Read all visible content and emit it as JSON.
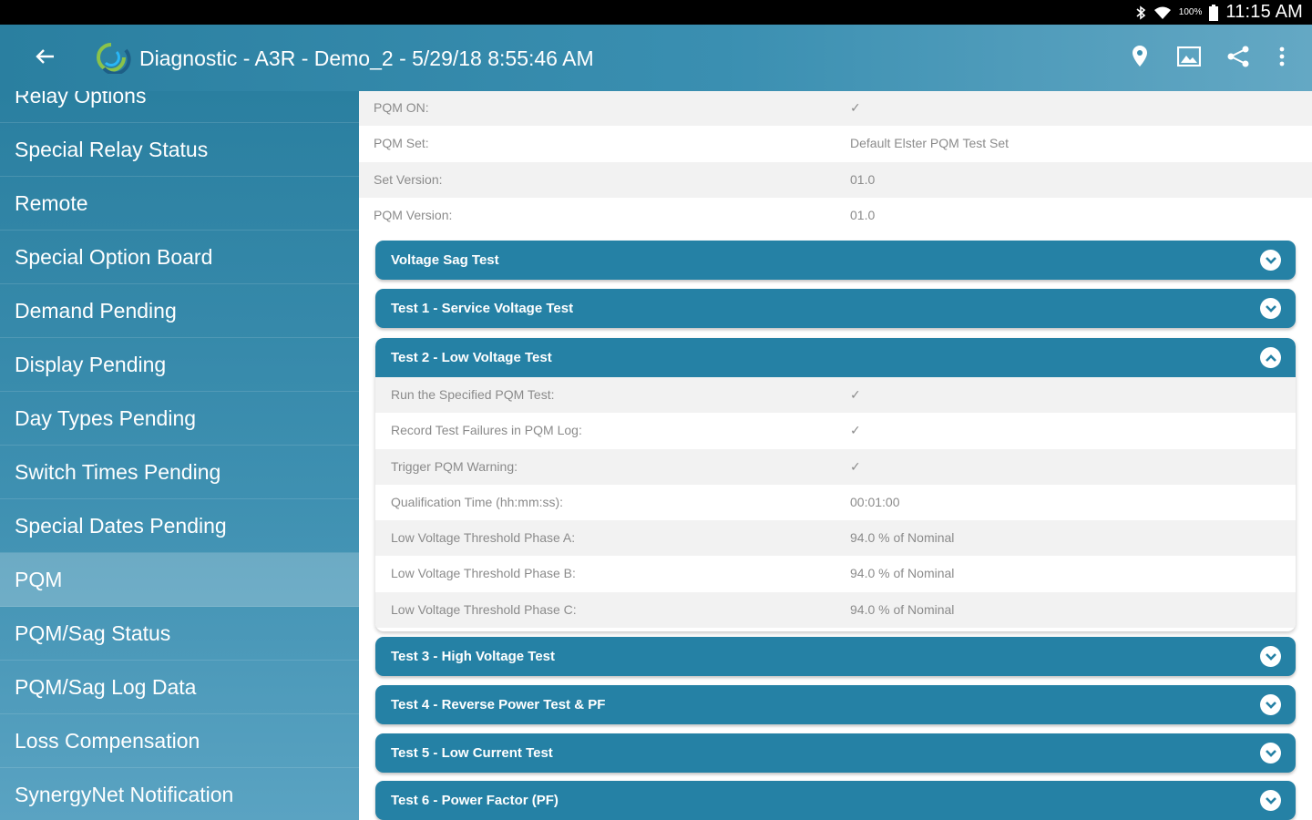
{
  "status_bar": {
    "battery_text": "100%",
    "time": "11:15 AM",
    "icons": [
      "bluetooth-icon",
      "wifi-icon",
      "battery-icon"
    ]
  },
  "app_bar": {
    "title": "Diagnostic - A3R - Demo_2 - 5/29/18 8:55:46 AM",
    "icons": [
      "back-arrow-icon",
      "app-logo",
      "location-pin-icon",
      "image-icon",
      "share-icon",
      "more-vert-icon"
    ]
  },
  "sidebar": {
    "selected": "PQM",
    "items": [
      "Relay Options",
      "Special Relay Status",
      "Remote",
      "Special Option Board",
      "Demand Pending",
      "Display Pending",
      "Day Types Pending",
      "Switch Times Pending",
      "Special Dates Pending",
      "PQM",
      "PQM/Sag Status",
      "PQM/Sag Log Data",
      "Loss Compensation",
      "SynergyNet Notification"
    ]
  },
  "main": {
    "rows": [
      {
        "label": "PQM ON:",
        "value": "✓"
      },
      {
        "label": "PQM Set:",
        "value": "Default Elster PQM Test Set"
      },
      {
        "label": "Set Version:",
        "value": "01.0"
      },
      {
        "label": "PQM Version:",
        "value": "01.0"
      }
    ],
    "sections": [
      {
        "label": "Voltage Sag Test",
        "expanded": false
      },
      {
        "label": "Test 1 - Service Voltage Test",
        "expanded": false
      },
      {
        "label": "Test 2 - Low Voltage Test",
        "expanded": true,
        "rows": [
          {
            "label": "Run the Specified PQM Test:",
            "value": "✓"
          },
          {
            "label": "Record Test Failures in PQM Log:",
            "value": "✓"
          },
          {
            "label": "Trigger PQM Warning:",
            "value": "✓"
          },
          {
            "label": "Qualification Time (hh:mm:ss):",
            "value": "00:01:00"
          },
          {
            "label": "Low Voltage Threshold Phase A:",
            "value": "94.0 % of Nominal"
          },
          {
            "label": "Low Voltage Threshold Phase B:",
            "value": "94.0 % of Nominal"
          },
          {
            "label": "Low Voltage Threshold Phase C:",
            "value": "94.0 % of Nominal"
          }
        ]
      },
      {
        "label": "Test 3 - High Voltage Test",
        "expanded": false
      },
      {
        "label": "Test 4 - Reverse Power Test & PF",
        "expanded": false
      },
      {
        "label": "Test 5 - Low Current Test",
        "expanded": false
      },
      {
        "label": "Test 6 - Power Factor (PF)",
        "expanded": false
      }
    ]
  },
  "colors": {
    "accent": "#2581a5",
    "appbar_start": "#2a7fa0",
    "appbar_end": "#64a8c4",
    "row_alt": "#f2f2f2",
    "text_muted": "#8b8b8b"
  }
}
